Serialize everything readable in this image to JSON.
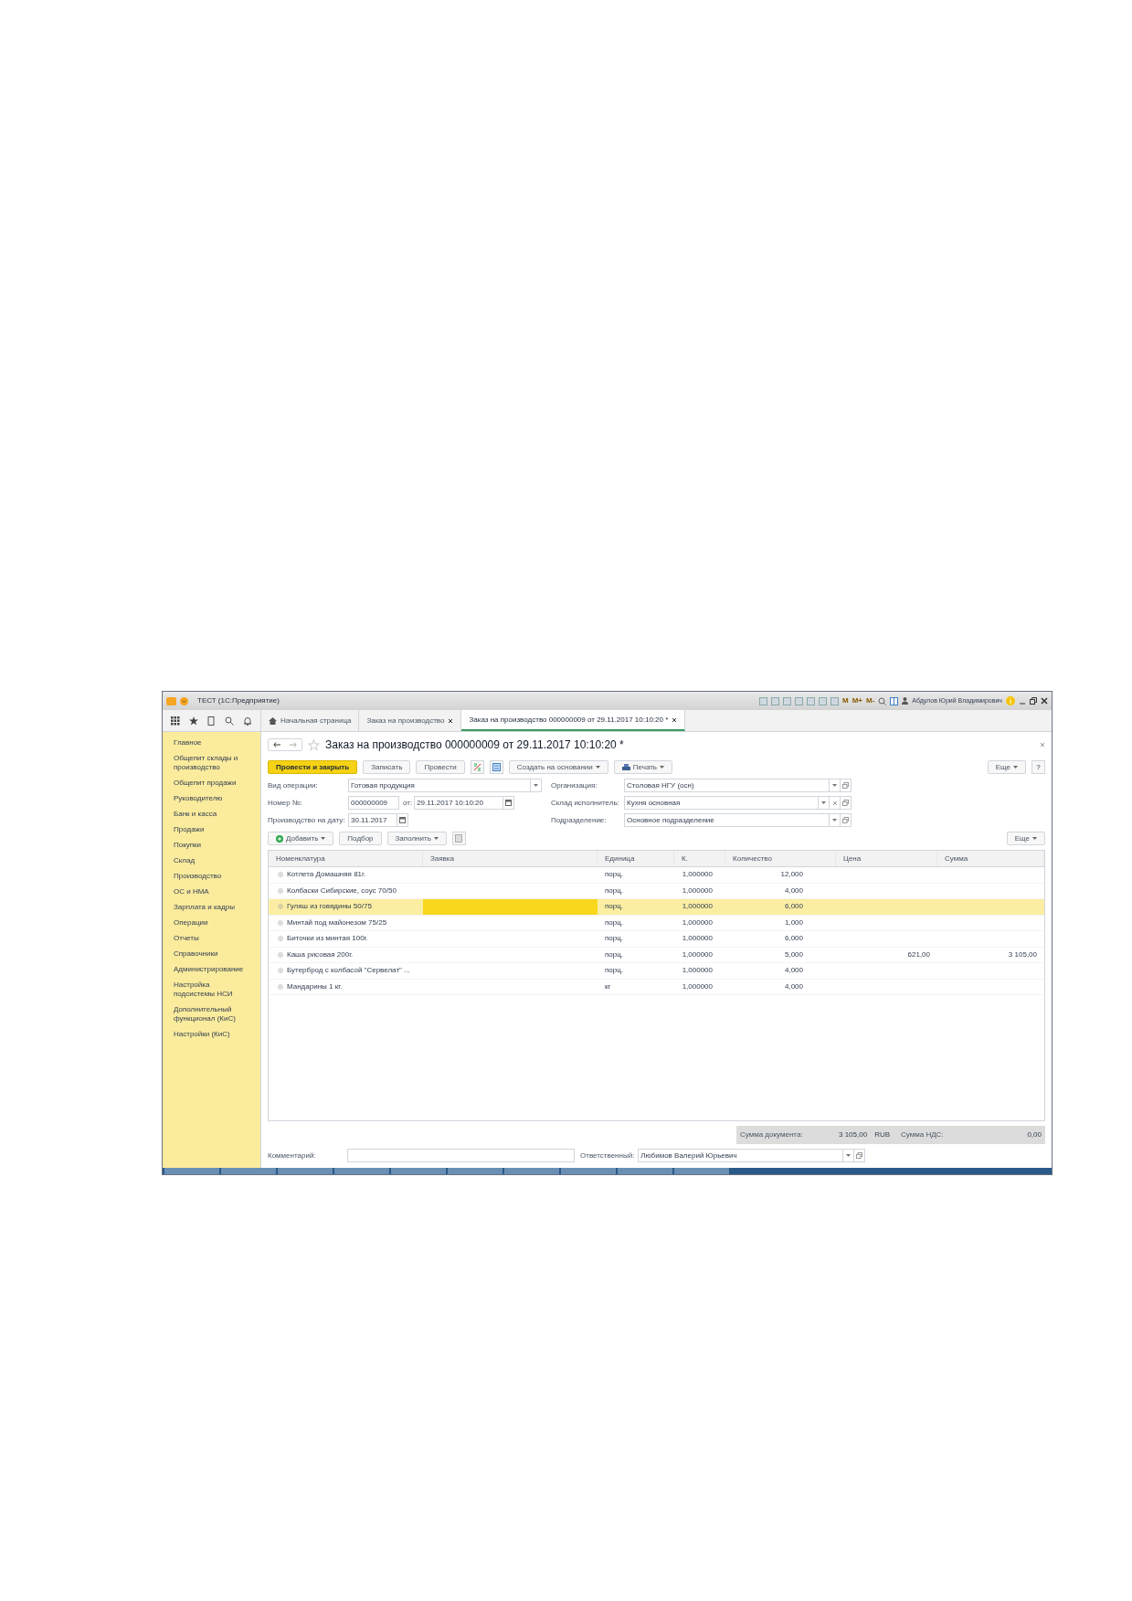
{
  "window": {
    "title": "ТЕСТ (1С:Предприятие)",
    "toolbar_labels": [
      "M",
      "M+",
      "M-"
    ],
    "user": "Абдулов Юрий Владимирович"
  },
  "tabs": [
    {
      "label": "Начальная страница",
      "kind": "home",
      "selected": false
    },
    {
      "label": "Заказ на производство",
      "kind": "page",
      "selected": false,
      "closable": true
    },
    {
      "label": "Заказ на производство 000000009 от 29.11.2017 10:10:20 *",
      "kind": "page",
      "selected": true,
      "closable": true
    }
  ],
  "sidebar": {
    "items": [
      "Главное",
      "Общепит склады и производство",
      "Общепит продажи",
      "Руководителю",
      "Банк и касса",
      "Продажи",
      "Покупки",
      "Склад",
      "Производство",
      "ОС и НМА",
      "Зарплата и кадры",
      "Операции",
      "Отчеты",
      "Справочники",
      "Администрирование",
      "Настройка подсистемы НСИ",
      "Дополнительный функционал (КиС)",
      "Настройки (КиС)"
    ]
  },
  "form": {
    "title": "Заказ на производство 000000009 от 29.11.2017 10:10:20 *",
    "buttons": [
      {
        "label": "Провести и закрыть",
        "kind": "primary"
      },
      {
        "label": "Записать",
        "kind": "plain"
      },
      {
        "label": "Провести",
        "kind": "plain"
      },
      {
        "kind": "dtkt"
      },
      {
        "kind": "structure"
      },
      {
        "label": "Создать на основании",
        "kind": "menu"
      },
      {
        "label": "Печать",
        "kind": "print"
      }
    ],
    "more": "Еще",
    "help": "?",
    "left_fields": [
      {
        "label": "Вид операции:",
        "value": "Готовая продукция",
        "kind": "choice"
      },
      {
        "label": "Номер №:",
        "value": "000000009",
        "kind": "text",
        "extra": {
          "label": "от:",
          "value": "29.11.2017 10:10:20",
          "kind": "date"
        }
      },
      {
        "label": "Производство на дату:",
        "value": "30.11.2017",
        "kind": "date"
      }
    ],
    "right_fields": [
      {
        "label": "Организация:",
        "value": "Столовая НГУ (осн)",
        "kind": "reference"
      },
      {
        "label": "Склад исполнитель:",
        "value": "Кухня основная",
        "kind": "reference_clearable"
      },
      {
        "label": "Подразделение:",
        "value": "Основное подразделение",
        "kind": "reference"
      }
    ]
  },
  "table_toolbar": {
    "buttons": [
      {
        "label": "Добавить",
        "kind": "add"
      },
      {
        "label": "Подбор",
        "kind": "plain"
      },
      {
        "label": "Заполнить",
        "kind": "menu"
      },
      {
        "kind": "copy"
      }
    ],
    "more": "Еще"
  },
  "table": {
    "columns": [
      "Номенклатура",
      "Заявка",
      "Единица",
      "К.",
      "Количество",
      "Цена",
      "Сумма"
    ],
    "rows": [
      {
        "cells": [
          "Котлета Домашняя 81г.",
          "",
          "порц.",
          "1,000000",
          "12,000",
          "",
          ""
        ],
        "selected": false
      },
      {
        "cells": [
          "Колбаски Сибирские, соус 70/50",
          "",
          "порц.",
          "1,000000",
          "4,000",
          "",
          ""
        ],
        "selected": false
      },
      {
        "cells": [
          "Гуляш из говядины 50/75",
          "",
          "порц.",
          "1,000000",
          "6,000",
          "",
          ""
        ],
        "selected": true
      },
      {
        "cells": [
          "Минтай под майонезом 75/25",
          "",
          "порц.",
          "1,000000",
          "1,000",
          "",
          ""
        ],
        "selected": false
      },
      {
        "cells": [
          "Биточки из минтая 100г.",
          "",
          "порц.",
          "1,000000",
          "6,000",
          "",
          ""
        ],
        "selected": false
      },
      {
        "cells": [
          "Каша рисовая 200г.",
          "",
          "порц.",
          "1,000000",
          "5,000",
          "621,00",
          "3 105,00"
        ],
        "selected": false
      },
      {
        "cells": [
          "Бутерброд с колбасой \"Сервелат\" ...",
          "",
          "порц.",
          "1,000000",
          "4,000",
          "",
          ""
        ],
        "selected": false
      },
      {
        "cells": [
          "Мандарины 1 кг.",
          "",
          "кг",
          "1,000000",
          "4,000",
          "",
          ""
        ],
        "selected": false
      }
    ]
  },
  "totals": {
    "doc_label": "Сумма документа:",
    "doc_value": "3 105,00",
    "currency": "RUB",
    "vat_label": "Сумма НДС:",
    "vat_value": "0,00"
  },
  "footer": {
    "comment_label": "Комментарий:",
    "responsible_label": "Ответственный:",
    "responsible_value": "Любимов Валерий Юрьевич"
  }
}
